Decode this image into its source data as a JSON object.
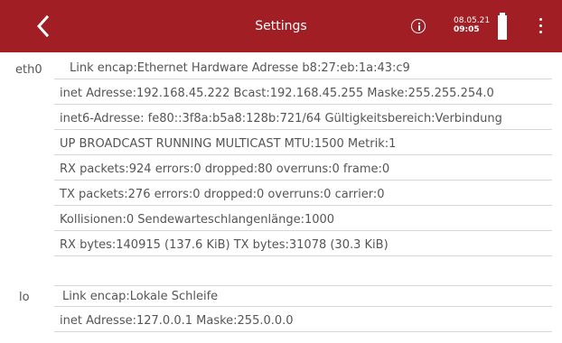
{
  "header": {
    "title": "Settings",
    "date": "08.05.21",
    "time": "09:05",
    "back_icon": "chevron-left-icon",
    "info_icon": "info-icon",
    "battery_icon": "battery-icon",
    "battery_level": 1.0,
    "menu_icon": "more-vert-icon",
    "bar_color": "#a01e24"
  },
  "interfaces": [
    {
      "name": "eth0",
      "lines": [
        "Link encap:Ethernet  Hardware Adresse b8:27:eb:1a:43:c9",
        "inet Adresse:192.168.45.222  Bcast:192.168.45.255  Maske:255.255.254.0",
        "inet6-Adresse: fe80::3f8a:b5a8:128b:721/64 Gültigkeitsbereich:Verbindung",
        "UP BROADCAST RUNNING MULTICAST  MTU:1500  Metrik:1",
        "RX packets:924 errors:0 dropped:80 overruns:0 frame:0",
        "TX packets:276 errors:0 dropped:0 overruns:0 carrier:0",
        "Kollisionen:0 Sendewarteschlangenlänge:1000",
        "RX bytes:140915 (137.6 KiB)  TX bytes:31078 (30.3 KiB)"
      ]
    },
    {
      "name": "lo",
      "lines": [
        "Link encap:Lokale Schleife",
        "inet Adresse:127.0.0.1  Maske:255.0.0.0"
      ]
    }
  ]
}
